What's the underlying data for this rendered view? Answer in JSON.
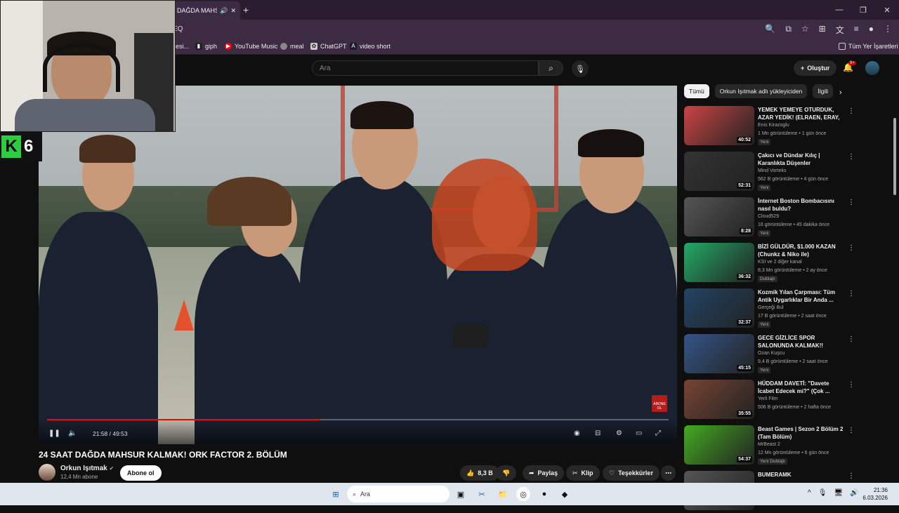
{
  "browser": {
    "tab_title": "DAĞDA MAHS",
    "url": "EQ",
    "bookmarks": [
      "esi...",
      "giph",
      "YouTube Music",
      "meal",
      "ChatGPT",
      "video short"
    ],
    "bookmarks_right": "Tüm Yer İşaretleri"
  },
  "yt": {
    "search_placeholder": "Ara",
    "create_label": "Oluştur",
    "notif_count": "9+"
  },
  "overlay": {
    "k_letter": "K",
    "k_number": "6"
  },
  "player": {
    "time": "21:58 / 49:53",
    "progress": 0.44,
    "abone_badge": "ABONE OL"
  },
  "video": {
    "title": "24 SAAT DAĞDA MAHSUR KALMAK! ORK FACTOR 2. BÖLÜM",
    "channel": "Orkun Işıtmak",
    "subs": "12,4 Mn abone",
    "subscribe": "Abone ol",
    "likes": "8,3 B",
    "share": "Paylaş",
    "clip": "Klip",
    "thanks": "Teşekkürler"
  },
  "chips": [
    "Tümü",
    "Orkun Işıtmak adlı yükleyiciden",
    "İlgili"
  ],
  "recs": [
    {
      "title": "YEMEK YEMEYE OTURDUK, AZAR YEDİK! (ELRAEN, ERAY, ...",
      "channel": "Enis Kirazoglu",
      "meta": "1 Mn görüntüleme • 1 gün önce",
      "tag": "Yeni",
      "dur": "40:52",
      "color": "#c44"
    },
    {
      "title": "Çakıcı ve Dündar Kılıç | Karanlıkta Düşenler",
      "channel": "Mind Vorteks",
      "meta": "562 B görüntüleme • 4 gün önce",
      "tag": "Yeni",
      "dur": "52:31",
      "color": "#333"
    },
    {
      "title": "İnternet Boston Bombacısını nasıl buldu?",
      "channel": "Cloud529",
      "meta": "16 görüntüleme • 45 dakika önce",
      "tag": "Yeni",
      "dur": "8:28",
      "color": "#555"
    },
    {
      "title": "BİZİ GÜLDÜR, $1.000 KAZAN (Chunkz & Niko ile)",
      "channel": "KSI  ve 2 diğer kanal",
      "meta": "8,3 Mn görüntüleme • 2 ay önce",
      "tag": "Dublajlı",
      "dur": "36:32",
      "color": "#2a6"
    },
    {
      "title": "Kozmik Yılan Çarpması: Tüm Antik Uygarlıklar Bir Anda ...",
      "channel": "Gerçeği Bul",
      "meta": "17 B görüntüleme • 2 saat önce",
      "tag": "Yeni",
      "dur": "32:37",
      "color": "#246"
    },
    {
      "title": "GECE GİZLİCE SPOR SALONUNDA KALMAK!!",
      "channel": "Ozan Kuşcu",
      "meta": "9,4 B görüntüleme • 2 saat önce",
      "tag": "Yeni",
      "dur": "45:15",
      "color": "#358"
    },
    {
      "title": "HÜDDAM DAVETİ: \"Davete İcabet Edecek mi?\" (Çok ...",
      "channel": "Yerli Film",
      "meta": "506 B görüntüleme • 2 hafta önce",
      "tag": "",
      "dur": "35:55",
      "color": "#743"
    },
    {
      "title": "Beast Games | Sezon 2 Bölüm 2 (Tam Bölüm)",
      "channel": "MrBeast 2",
      "meta": "12 Mn görüntüleme • 6 gün önce",
      "tag": "Yeni  Dublajlı",
      "dur": "54:37",
      "color": "#4a2"
    },
    {
      "title": "BUMERAMK",
      "channel": "",
      "meta": "",
      "tag": "",
      "dur": "",
      "color": "#555"
    }
  ],
  "taskbar": {
    "search": "Ara",
    "time": "21:36",
    "date": "6.03.2026"
  }
}
